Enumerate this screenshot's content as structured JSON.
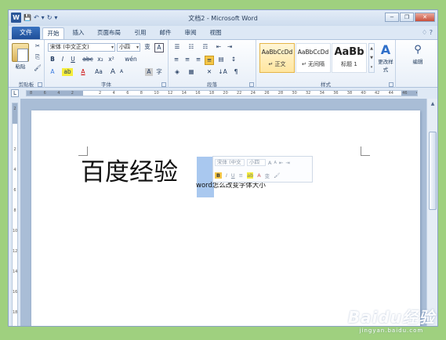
{
  "app": {
    "title": "文档2 - Microsoft Word"
  },
  "qat": {
    "word_logo": "W",
    "save": "💾",
    "undo": "↶",
    "undo_drop": "▾",
    "redo": "↻",
    "customize": "▾"
  },
  "window_controls": {
    "minimize": "−",
    "restore": "❐",
    "close": "✕"
  },
  "tabs": {
    "file": "文件",
    "items": [
      "开始",
      "插入",
      "页面布局",
      "引用",
      "邮件",
      "审阅",
      "视图"
    ],
    "right_icons": "♢ ?"
  },
  "ribbon": {
    "clipboard": {
      "label": "剪贴板",
      "paste": "粘贴",
      "cut": "✂",
      "copy": "⎘",
      "format_painter": "🖌"
    },
    "font": {
      "label": "字体",
      "font_name": "宋体 (中文正文)",
      "font_size": "小四",
      "wen": "变",
      "a_box": "A",
      "bold": "B",
      "italic": "I",
      "underline": "U",
      "strike": "abc",
      "subscript": "x₂",
      "superscript": "x²",
      "clear": "A",
      "text_effects": "A",
      "highlight": "ab",
      "font_color": "A",
      "change_case": "Aa",
      "grow": "A",
      "shrink": "A",
      "phonetic": "wén",
      "char_border": "A",
      "enclose": "字"
    },
    "paragraph": {
      "label": "段落",
      "bullets": "☰",
      "numbering": "☷",
      "multilevel": "☶",
      "decrease_indent": "⇤",
      "increase_indent": "⇥",
      "align_left": "≡",
      "center": "≡",
      "align_right": "≡",
      "justify": "≡",
      "distributed": "▤",
      "line_spacing": "↕",
      "chinese_layout": "✕",
      "sort": "↓A",
      "show_marks": "¶",
      "shading": "◈",
      "borders": "▦"
    },
    "styles": {
      "label": "样式",
      "items": [
        {
          "sample": "AaBbCcDd",
          "name": "↵ 正文"
        },
        {
          "sample": "AaBbCcDd",
          "name": "↵ 无间隔"
        },
        {
          "sample": "AaBb",
          "name": "标题 1"
        }
      ],
      "change_styles": "更改样式",
      "scroll": "▲ ▼ ▾"
    },
    "editing": {
      "label": "编辑"
    }
  },
  "ruler": {
    "tab_selector": "L",
    "h_ticks": [
      "8",
      "6",
      "4",
      "2",
      "",
      "2",
      "4",
      "6",
      "8",
      "10",
      "12",
      "14",
      "16",
      "18",
      "20",
      "22",
      "24",
      "26",
      "28",
      "30",
      "32",
      "34",
      "36",
      "38",
      "40",
      "42",
      "44",
      "46",
      "48"
    ],
    "v_ticks": [
      "2",
      "",
      "2",
      "4",
      "6",
      "8",
      "10",
      "12",
      "14",
      "16",
      "18"
    ]
  },
  "document": {
    "big_text": "百度经验",
    "small_text": "word怎么改变字体大小"
  },
  "mini_toolbar": {
    "font": "宋体 (中文",
    "size": "小四",
    "grow": "A",
    "shrink": "A",
    "indent1": "⇤",
    "indent2": "⇥",
    "bold": "B",
    "italic": "I",
    "underline": "U",
    "center": "≡",
    "highlight": "ab",
    "font_color": "A",
    "wen": "变",
    "painter": "🖌"
  },
  "scrollbar": {
    "up": "▲"
  },
  "watermark": {
    "line1": "Baidu经验",
    "line2": "jingyan.baidu.com"
  }
}
